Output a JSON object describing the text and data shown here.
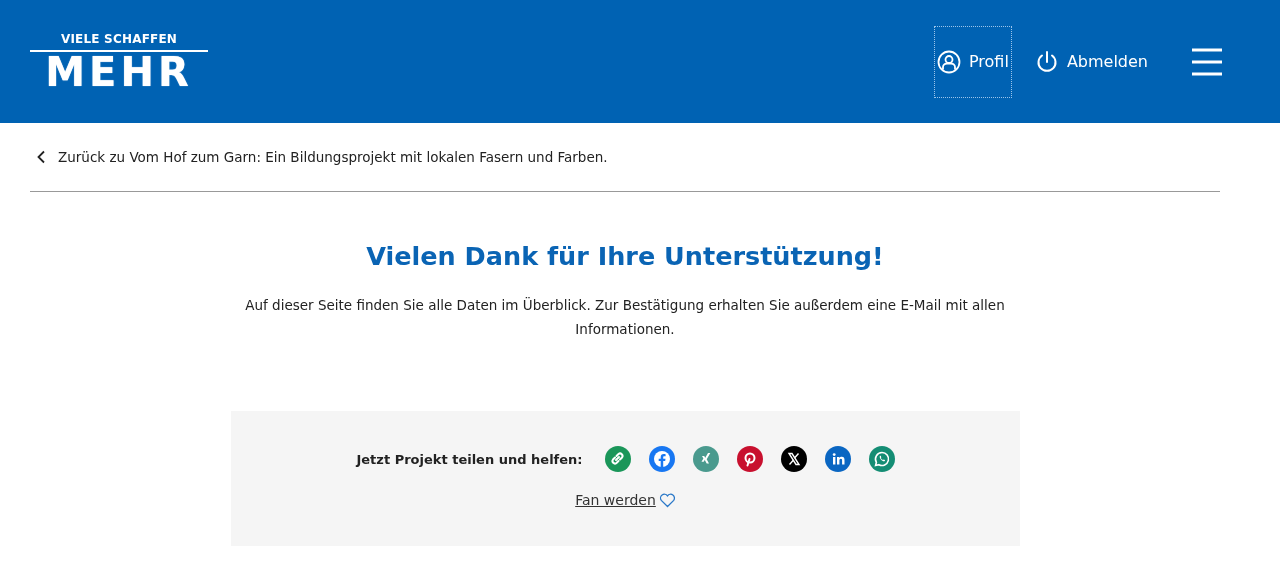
{
  "header": {
    "logo": {
      "tagline": "VIELE SCHAFFEN",
      "word": "MEHR"
    },
    "nav": [
      {
        "kind": "profile",
        "label": "Profil",
        "focused": true
      },
      {
        "kind": "logout",
        "label": "Abmelden",
        "focused": false
      }
    ]
  },
  "back_link": {
    "label": "Zurück zu Vom Hof zum Garn: Ein Bildungsprojekt mit lokalen Fasern und Farben."
  },
  "heading": "Vielen Dank für Ihre Unterstützung!",
  "intro": "Auf dieser Seite finden Sie alle Daten im Überblick. Zur Bestätigung erhalten Sie außerdem eine E-Mail mit allen Informationen.",
  "share": {
    "label": "Jetzt Projekt teilen und helfen:",
    "buttons": [
      {
        "kind": "link",
        "color": "#1a9659"
      },
      {
        "kind": "facebook",
        "color": "#1877f2"
      },
      {
        "kind": "xing",
        "color": "#4a9a8e"
      },
      {
        "kind": "pinterest",
        "color": "#c8102e"
      },
      {
        "kind": "x",
        "color": "#000000"
      },
      {
        "kind": "linkedin",
        "color": "#0a66c2"
      },
      {
        "kind": "whatsapp",
        "color": "#148d74"
      }
    ],
    "fan_link": "Fan werden"
  }
}
